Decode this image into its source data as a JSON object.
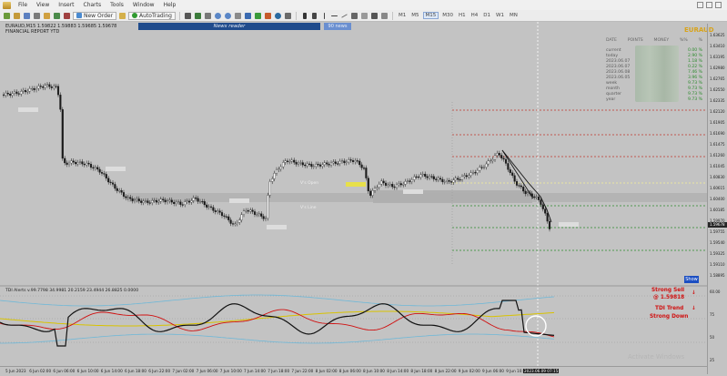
{
  "menu": [
    "File",
    "View",
    "Insert",
    "Charts",
    "Tools",
    "Window",
    "Help"
  ],
  "toolbar": {
    "new_order": "New Order",
    "autotrading": "AutoTrading",
    "timeframes": [
      "M1",
      "M5",
      "M15",
      "M30",
      "H1",
      "H4",
      "D1",
      "W1",
      "MN"
    ],
    "active_timeframe": "M15"
  },
  "chart": {
    "symbol_line": "EURAUD,M15  1.59822 1.59883 1.59685 1.59678",
    "report_line": "FINANCIAL REPORT YTD",
    "news_reader": "News reader",
    "news_badge": "90 news",
    "brand": "EURAUD",
    "levels": [
      "1.61416",
      "1.61085",
      "1.60624",
      "1.60263",
      "1.59951"
    ],
    "zone_labels": [
      "V's Open",
      "V's Line"
    ],
    "show_button": "Show"
  },
  "stats": {
    "headers": [
      "DATE",
      "POINTS",
      "MONEY",
      "%%",
      "%"
    ],
    "rows": [
      {
        "label": "current",
        "value": "0.00 %"
      },
      {
        "label": "today",
        "value": "2.90 %"
      },
      {
        "label": "2023.06.07",
        "value": "1.18 %"
      },
      {
        "label": "2023.06.07",
        "value": "0.22 %"
      },
      {
        "label": "2023.06.08",
        "value": "7.46 %"
      },
      {
        "label": "2023.06.05",
        "value": "3.96 %"
      },
      {
        "label": "week",
        "value": "9.73 %"
      },
      {
        "label": "month",
        "value": "9.73 %"
      },
      {
        "label": "quarter",
        "value": "9.73 %"
      },
      {
        "label": "year",
        "value": "9.73 %"
      }
    ]
  },
  "price_scale": {
    "ticks": [
      "1.63625",
      "1.63410",
      "1.63195",
      "1.62980",
      "1.62765",
      "1.62550",
      "1.62335",
      "1.62120",
      "1.61905",
      "1.61690",
      "1.61475",
      "1.61260",
      "1.61045",
      "1.60830",
      "1.60615",
      "1.60400",
      "1.60185",
      "1.59970",
      "1.59755",
      "1.59540",
      "1.59325",
      "1.59110",
      "1.58895"
    ],
    "current": "1.59678",
    "indicator_ticks": [
      "60.00",
      "75",
      "50",
      "25"
    ]
  },
  "indicator": {
    "title": "TDI Alerts v.99.7798 34.9981 20.2159 23.4944 26.8825 0.0000",
    "signal": {
      "line1": "Strong Sell",
      "line2": "@ 1.59818",
      "line3": "TDI Trend",
      "line4": "Strong Down",
      "arrow": "↓"
    }
  },
  "time_axis": [
    "5 Jun 2023",
    "6 Jun 02:00",
    "6 Jun 06:00",
    "6 Jun 10:00",
    "6 Jun 14:00",
    "6 Jun 18:00",
    "6 Jun 22:00",
    "7 Jun 02:00",
    "7 Jun 06:00",
    "7 Jun 10:00",
    "7 Jun 14:00",
    "7 Jun 18:00",
    "7 Jun 22:00",
    "8 Jun 02:00",
    "8 Jun 06:00",
    "8 Jun 10:00",
    "8 Jun 14:00",
    "8 Jun 18:00",
    "8 Jun 22:00",
    "9 Jun 02:00",
    "9 Jun 06:00",
    "9 Jun 10:00"
  ],
  "time_highlight": "2023.06.09 07:15",
  "watermark": "Activate Windows",
  "colors": {
    "level_red": "#c0392b",
    "level_green": "#2e8b2e",
    "signal_red": "#d01010",
    "tdi_yellow": "#d9c300",
    "tdi_black": "#111111",
    "tdi_red": "#d01010",
    "band_blue": "#6fb8d8"
  }
}
